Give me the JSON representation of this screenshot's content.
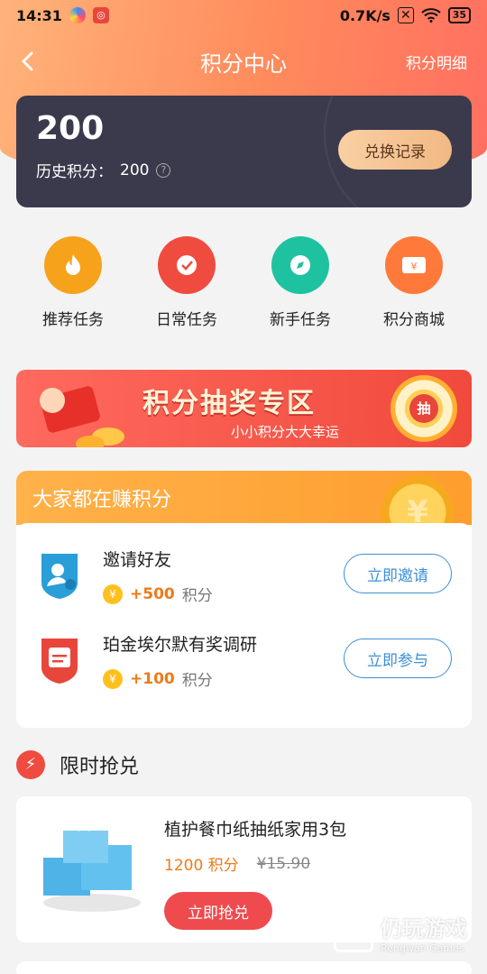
{
  "status_bar": {
    "time": "14:31",
    "net_speed": "0.7K/s",
    "battery": "35"
  },
  "nav": {
    "back_icon": "chevron-left-icon",
    "title": "积分中心",
    "right_link": "积分明细"
  },
  "points": {
    "value": "200",
    "history_label": "历史积分：",
    "history_value": "200",
    "exchange_label": "兑换记录"
  },
  "quick_tasks": [
    {
      "label": "推荐任务",
      "icon": "flame-icon",
      "color": "#f7a21b"
    },
    {
      "label": "日常任务",
      "icon": "check-icon",
      "color": "#ef4b3f"
    },
    {
      "label": "新手任务",
      "icon": "compass-icon",
      "color": "#1fc2a0"
    },
    {
      "label": "积分商城",
      "icon": "coupon-icon",
      "color": "#ff7a3a"
    }
  ],
  "lottery": {
    "title": "积分抽奖专区",
    "subtitle": "小小积分大大幸运",
    "wheel_label": "抽"
  },
  "earn": {
    "title": "大家都在赚积分",
    "tasks": [
      {
        "title": "邀请好友",
        "reward": "+500",
        "unit": "积分",
        "button": "立即邀请"
      },
      {
        "title": "珀金埃尔默有奖调研",
        "reward": "+100",
        "unit": "积分",
        "button": "立即参与"
      }
    ]
  },
  "flash": {
    "title": "限时抢兑",
    "product": {
      "name": "植护餐巾纸抽纸家用3包",
      "points": "1200 积分",
      "old_price": "¥15.90",
      "button": "立即抢兑"
    }
  },
  "watermark": {
    "cn": "仍玩游戏",
    "en": "Rengwan Games"
  }
}
